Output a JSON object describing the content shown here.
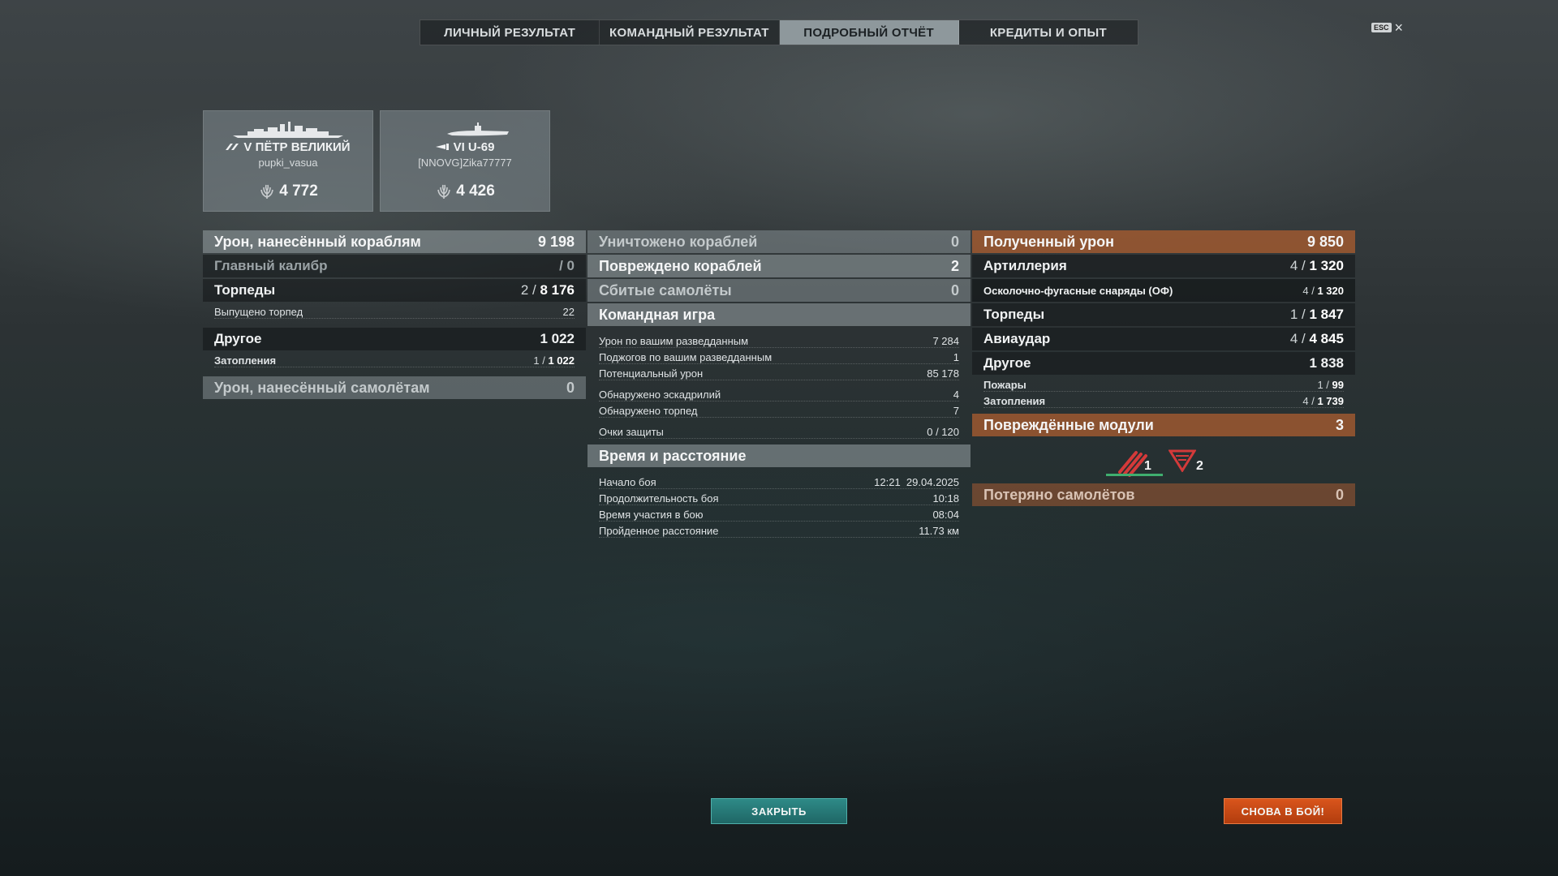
{
  "tabs": [
    {
      "label": "ЛИЧНЫЙ РЕЗУЛЬТАТ"
    },
    {
      "label": "КОМАНДНЫЙ РЕЗУЛЬТАТ"
    },
    {
      "label": "ПОДРОБНЫЙ ОТЧЁТ"
    },
    {
      "label": "КРЕДИТЫ И ОПЫТ"
    }
  ],
  "active_tab": "ПОДРОБНЫЙ ОТЧЁТ",
  "esc": {
    "key": "ESC",
    "close_icon": "×"
  },
  "ships": [
    {
      "tier": "V",
      "name": "ПЁТР ВЕЛИКИЙ",
      "player": "pupki_vasua",
      "xp": "4 772"
    },
    {
      "tier": "VI",
      "name": "U-69",
      "player": "[NNOVG]Zika77777",
      "xp": "4 426"
    }
  ],
  "left": {
    "ship_damage": {
      "label": "Урон, нанесённый кораблям",
      "value": "9 198"
    },
    "main_caliber": {
      "label": "Главный калибр",
      "value": "/ 0"
    },
    "torpedoes": {
      "label": "Торпеды",
      "hits": "2",
      "value": "8 176"
    },
    "torpedoes_fired": {
      "label": "Выпущено торпед",
      "value": "22"
    },
    "other": {
      "label": "Другое",
      "value": "1 022"
    },
    "flooding": {
      "label": "Затопления",
      "count": "1",
      "value": "1 022"
    },
    "plane_damage": {
      "label": "Урон, нанесённый самолётам",
      "value": "0"
    }
  },
  "middle": {
    "destroyed": {
      "label": "Уничтожено кораблей",
      "value": "0"
    },
    "damaged": {
      "label": "Повреждено кораблей",
      "value": "2"
    },
    "planes_shot": {
      "label": "Сбитые самолёты",
      "value": "0"
    },
    "team_header": "Командная игра",
    "team": [
      {
        "label": "Урон по вашим разведданным",
        "value": "7 284"
      },
      {
        "label": "Поджогов по вашим разведданным",
        "value": "1"
      },
      {
        "label": "Потенциальный урон",
        "value": "85 178"
      },
      {
        "label": "Обнаружено эскадрилий",
        "value": "4"
      },
      {
        "label": "Обнаружено торпед",
        "value": "7"
      },
      {
        "label": "Очки защиты",
        "value": "0 / 120"
      }
    ],
    "time_header": "Время и расстояние",
    "time": [
      {
        "label": "Начало боя",
        "value": "12:21  29.04.2025"
      },
      {
        "label": "Продолжительность боя",
        "value": "10:18"
      },
      {
        "label": "Время участия в бою",
        "value": "08:04"
      },
      {
        "label": "Пройденное расстояние",
        "value": "11.73 км"
      }
    ]
  },
  "right": {
    "received": {
      "label": "Полученный урон",
      "value": "9 850"
    },
    "artillery": {
      "label": "Артиллерия",
      "count": "4",
      "value": "1 320"
    },
    "he_shells": {
      "label": "Осколочно-фугасные снаряды (ОФ)",
      "count": "4",
      "value": "1 320"
    },
    "torpedoes": {
      "label": "Торпеды",
      "count": "1",
      "value": "1 847"
    },
    "air_strike": {
      "label": "Авиаудар",
      "count": "4",
      "value": "4 845"
    },
    "other": {
      "label": "Другое",
      "value": "1 838"
    },
    "fires": {
      "label": "Пожары",
      "count": "1",
      "value": "99"
    },
    "flooding": {
      "label": "Затопления",
      "count": "4",
      "value": "1 739"
    },
    "modules_header": {
      "label": "Повреждённые модули",
      "value": "3"
    },
    "modules": [
      {
        "icon": "torpedo-tubes-icon",
        "count": "1"
      },
      {
        "icon": "aa-guns-icon",
        "count": "2"
      }
    ],
    "planes_lost": {
      "label": "Потеряно самолётов",
      "value": "0"
    }
  },
  "buttons": {
    "close": "ЗАКРЫТЬ",
    "battle": "СНОВА В БОЙ!"
  },
  "colors": {
    "orange_header": "#a85c30",
    "close_button": "#2e8a87",
    "battle_button": "#d9551c",
    "module_damaged": "#d43a3a"
  }
}
